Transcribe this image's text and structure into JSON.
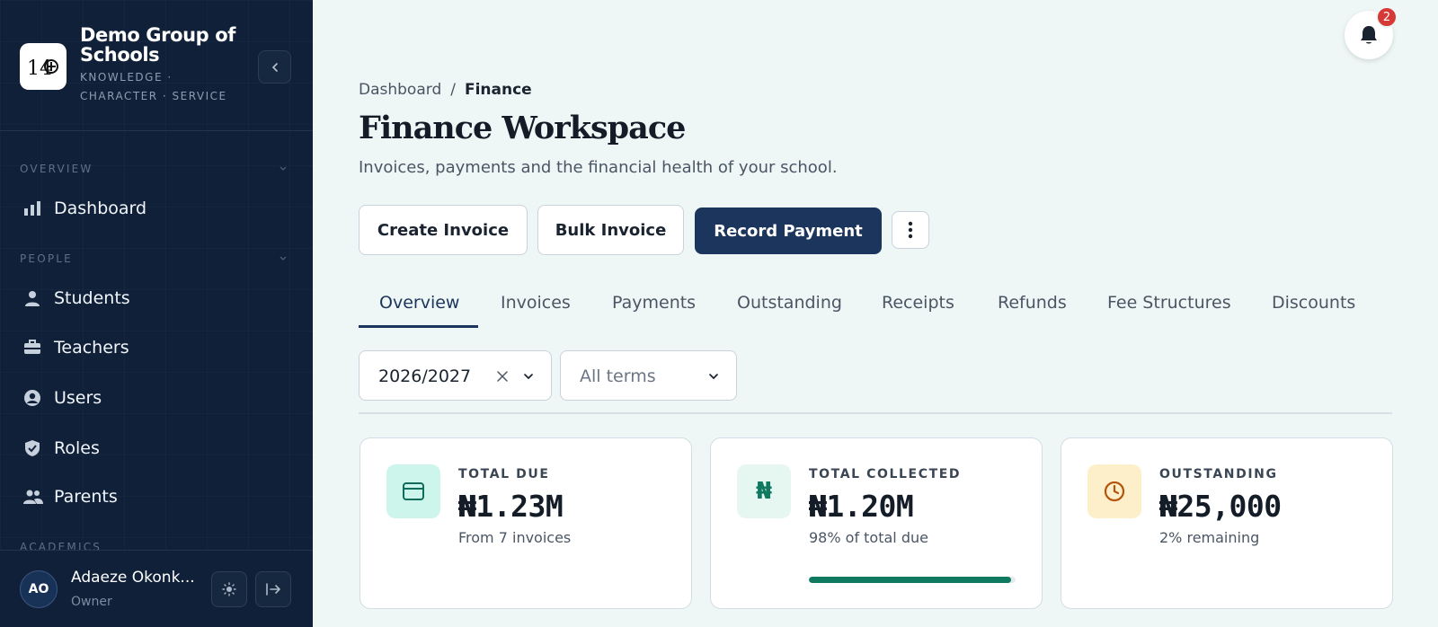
{
  "sidebar": {
    "brand_name": "Demo Group of Schools",
    "brand_tagline": "KNOWLEDGE · CHARACTER · SERVICE",
    "sections": [
      {
        "label": "OVERVIEW",
        "items": [
          {
            "label": "Dashboard",
            "icon": "bar-chart-icon"
          }
        ]
      },
      {
        "label": "PEOPLE",
        "items": [
          {
            "label": "Students",
            "icon": "person-icon"
          },
          {
            "label": "Teachers",
            "icon": "briefcase-icon"
          },
          {
            "label": "Users",
            "icon": "user-circle-icon"
          },
          {
            "label": "Roles",
            "icon": "shield-check-icon"
          },
          {
            "label": "Parents",
            "icon": "people-icon"
          }
        ]
      },
      {
        "label": "ACADEMICS",
        "items": []
      }
    ],
    "user": {
      "initials": "AO",
      "name": "Adaeze Okonk...",
      "role": "Owner"
    }
  },
  "notifications": {
    "count": "2"
  },
  "breadcrumb": {
    "parent": "Dashboard",
    "separator": "/",
    "current": "Finance"
  },
  "page": {
    "title": "Finance Workspace",
    "subtitle": "Invoices, payments and the financial health of your school."
  },
  "actions": {
    "create_invoice": "Create Invoice",
    "bulk_invoice": "Bulk Invoice",
    "record_payment": "Record Payment"
  },
  "tabs": [
    "Overview",
    "Invoices",
    "Payments",
    "Outstanding",
    "Receipts",
    "Refunds",
    "Fee Structures",
    "Discounts"
  ],
  "active_tab": "Overview",
  "filters": {
    "session": "2026/2027",
    "term_placeholder": "All terms"
  },
  "cards": [
    {
      "label": "TOTAL DUE",
      "value": "₦1.23M",
      "sub": "From 7 invoices",
      "icon": "card-icon",
      "icon_bg": "#cdf5ec",
      "icon_color": "#0f6b5a"
    },
    {
      "label": "TOTAL COLLECTED",
      "value": "₦1.20M",
      "sub": "98% of total due",
      "icon": "naira-icon",
      "icon_bg": "#e6f7f1",
      "icon_color": "#0f7a5f",
      "progress": 0.98
    },
    {
      "label": "OUTSTANDING",
      "value": "₦25,000",
      "sub": "2% remaining",
      "icon": "clock-icon",
      "icon_bg": "#fdefc9",
      "icon_color": "#b4540c"
    }
  ],
  "colors": {
    "sidebar_bg": "#0f2038",
    "primary": "#1c355c",
    "accent_green": "#0f7a5f",
    "badge_red": "#d63a36"
  }
}
